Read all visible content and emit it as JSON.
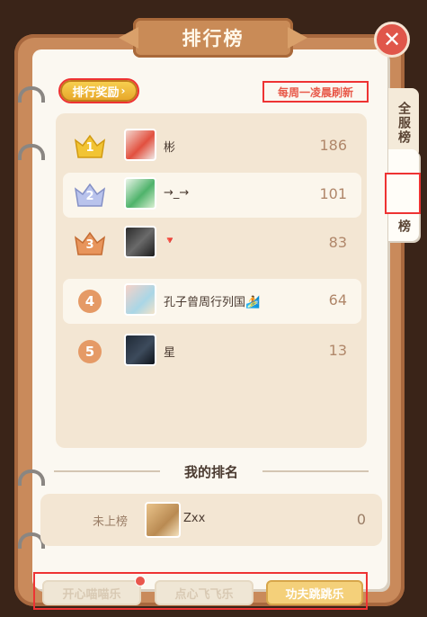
{
  "title": "排行榜",
  "close_label": "✕",
  "reward_button": "排行奖励",
  "refresh_note": "每周一凌晨刷新",
  "tabs": {
    "all_server": "全服榜",
    "friends": "榜"
  },
  "leaderboard": [
    {
      "rank": "1",
      "name": "彬",
      "score": "186"
    },
    {
      "rank": "2",
      "name": "→_→",
      "score": "101"
    },
    {
      "rank": "3",
      "name": "🔻",
      "score": "83"
    },
    {
      "rank": "4",
      "name": "孔子曾周行列国🏄",
      "score": "64"
    },
    {
      "rank": "5",
      "name": "星",
      "score": "13"
    }
  ],
  "my_rank": {
    "heading": "我的排名",
    "status": "未上榜",
    "name": "Zxx",
    "score": "0"
  },
  "game_tabs": [
    {
      "label": "开心喵喵乐",
      "active": false
    },
    {
      "label": "点心飞飞乐",
      "active": false
    },
    {
      "label": "功夫跳跳乐",
      "active": true
    }
  ],
  "colors": {
    "gold": "#f2c434",
    "silver": "#b9c3ec",
    "bronze": "#e8955c",
    "accent_red": "#e85a4a"
  }
}
